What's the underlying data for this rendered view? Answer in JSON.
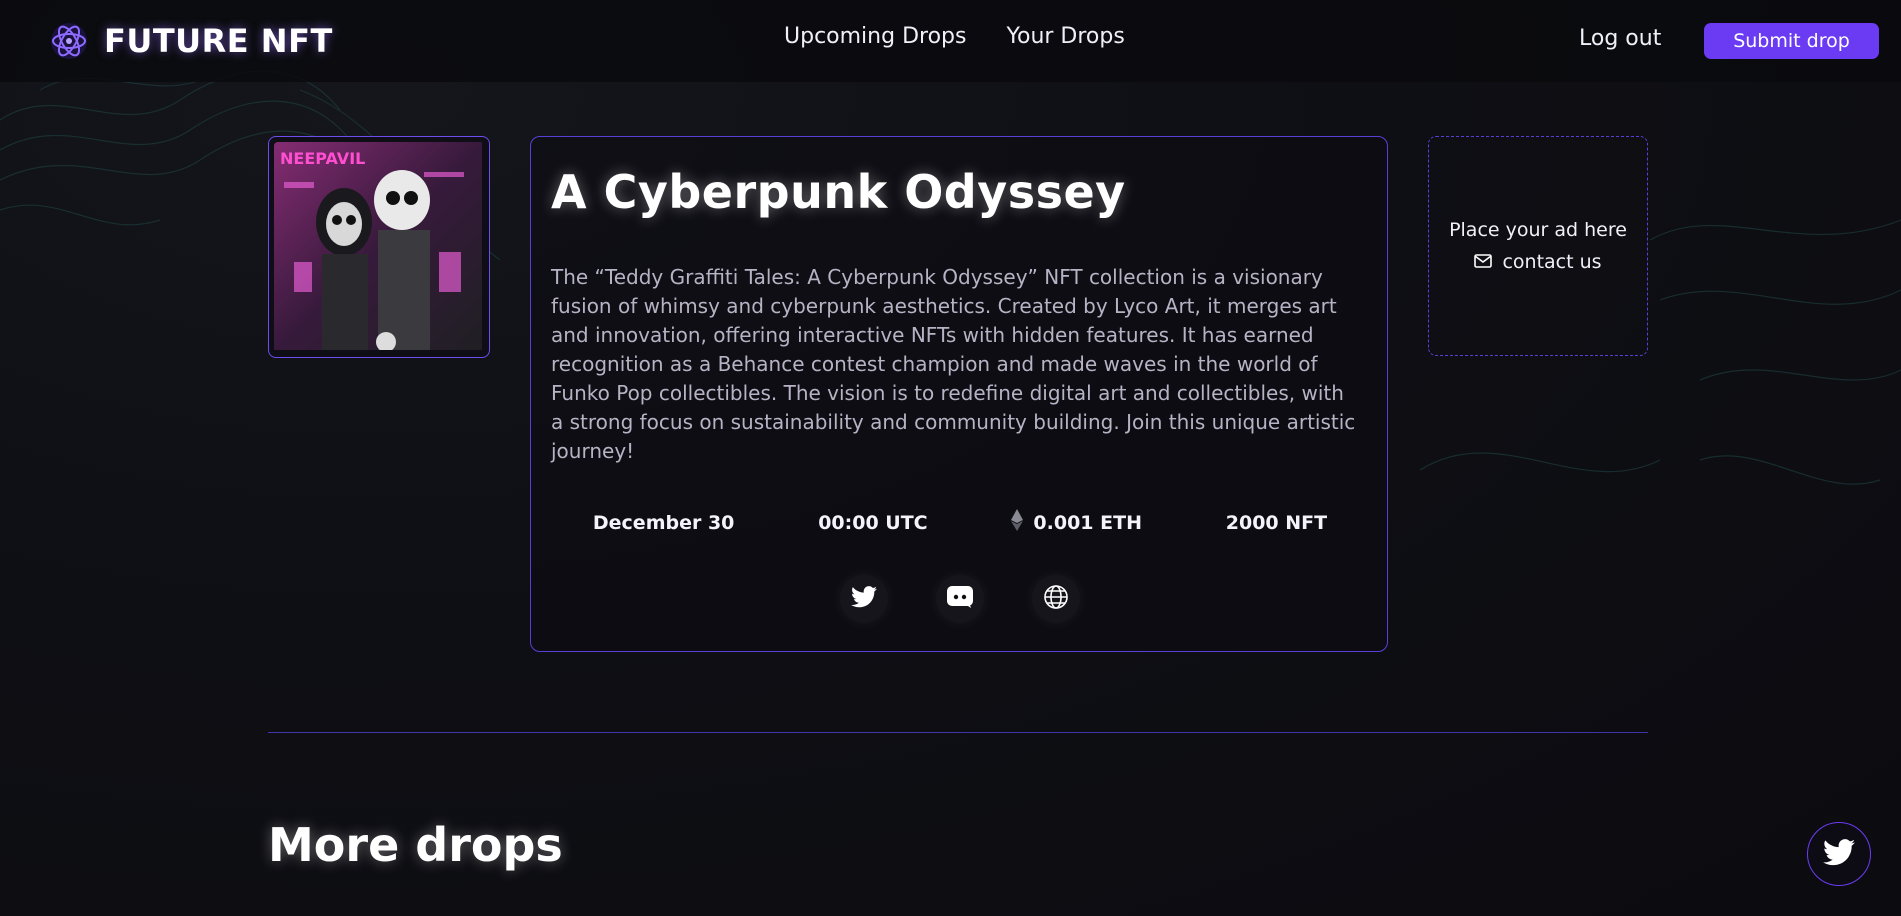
{
  "header": {
    "logo_text": "FUTURE NFT",
    "nav": [
      "Upcoming Drops",
      "Your Drops"
    ],
    "logout": "Log out",
    "submit": "Submit drop"
  },
  "drop": {
    "title": "A Cyberpunk Odyssey",
    "description": "The “Teddy Graffiti Tales: A Cyberpunk Odyssey” NFT collection is a visionary fusion of whimsy and cyberpunk aesthetics. Created by Lyco Art, it merges art and innovation, offering interactive NFTs with hidden features. It has earned recognition as a Behance contest champion and made waves in the world of Funko Pop collectibles. The vision is to redefine digital art and collectibles, with a strong focus on sustainability and community building. Join this unique artistic journey!",
    "date": "December 30",
    "time": "00:00 UTC",
    "price": "0.001 ETH",
    "supply": "2000 NFT",
    "socials": [
      "twitter-icon",
      "discord-icon",
      "globe-icon"
    ]
  },
  "ad": {
    "text": "Place your ad here",
    "contact": "contact us"
  },
  "more_drops": "More drops",
  "colors": {
    "accent": "#6b3bf3",
    "border": "#5a3fd6",
    "background": "#0e0f14"
  }
}
